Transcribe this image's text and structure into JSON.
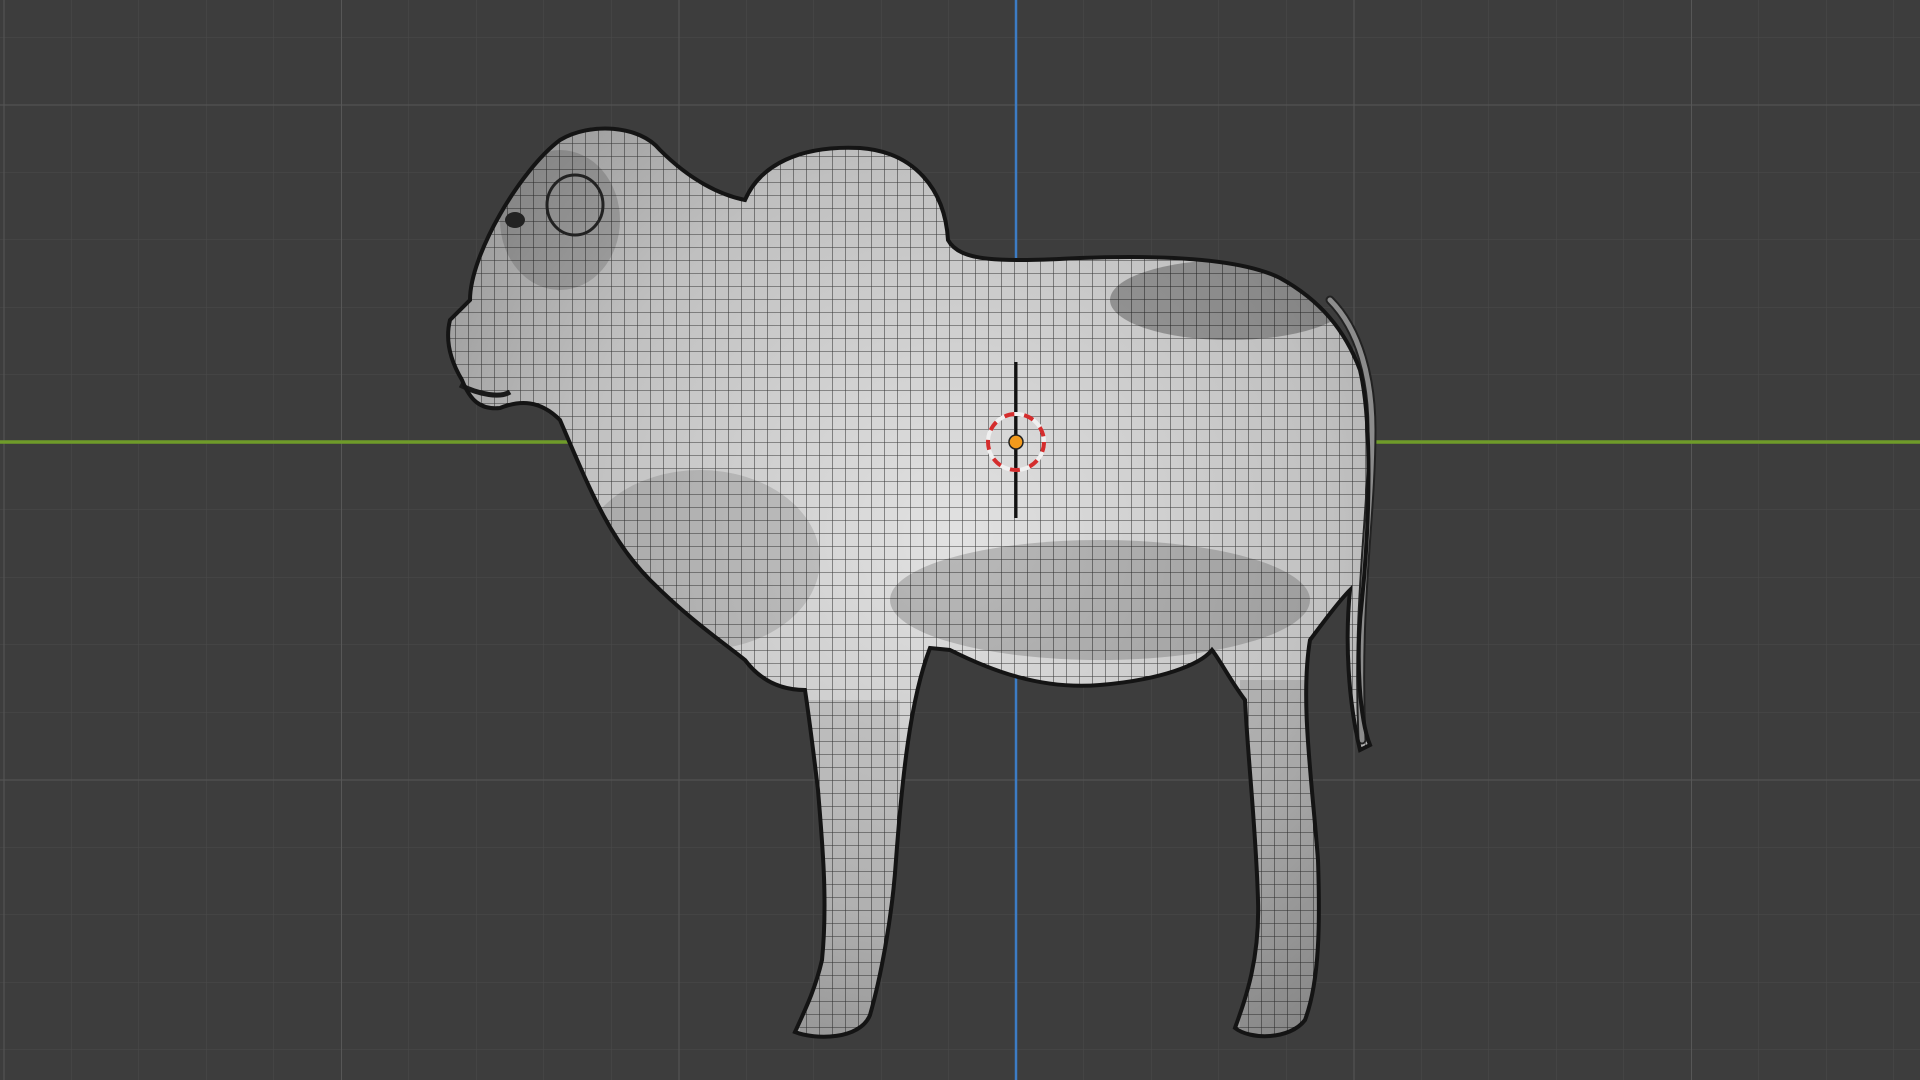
{
  "viewport": {
    "view": "orthographic-side",
    "object_name": "zebu-calf-mesh",
    "display_mode": "solid-with-wireframe-overlay"
  },
  "colors": {
    "background": "#3d3d3d",
    "grid_minor": "#4a4a4a",
    "grid_major": "#555555",
    "x_axis": "#6f9b2a",
    "z_axis": "#3d7cc4",
    "mesh_fill": "#c4c4c4",
    "mesh_wire": "#1e1e1e",
    "cursor_ring_red": "#d42d2d",
    "cursor_ring_white": "#f0f0f0",
    "origin_dot": "#f39a1c"
  },
  "icons": {
    "cursor": "3d-cursor-icon",
    "origin": "object-origin-icon"
  }
}
